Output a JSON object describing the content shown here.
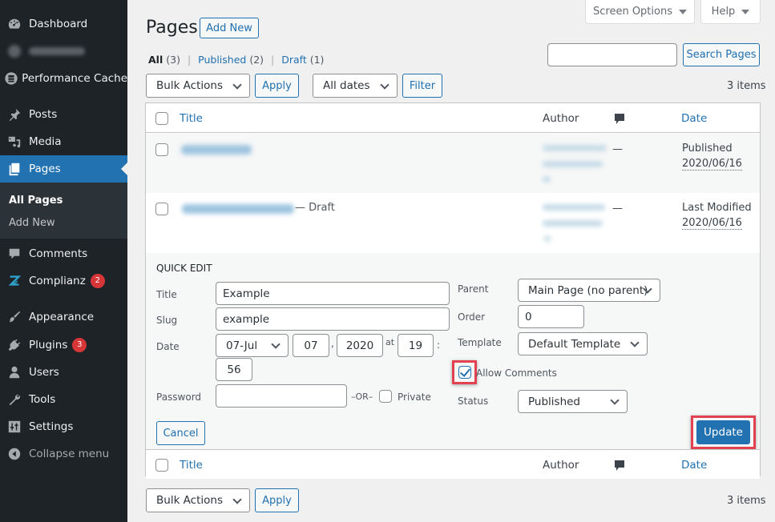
{
  "sidebar": {
    "items": [
      {
        "label": "Dashboard",
        "icon": "dashboard-icon"
      },
      {
        "label": "",
        "icon": "redacted-icon",
        "redacted": true
      },
      {
        "label": "Performance Cache",
        "icon": "cache-icon"
      },
      {
        "label": "Posts",
        "icon": "pin-icon"
      },
      {
        "label": "Media",
        "icon": "media-icon"
      },
      {
        "label": "Pages",
        "icon": "pages-icon",
        "active": true
      },
      {
        "label": "Comments",
        "icon": "comment-icon"
      },
      {
        "label": "Complianz",
        "icon": "complianz-icon",
        "badge": "2"
      },
      {
        "label": "Appearance",
        "icon": "brush-icon"
      },
      {
        "label": "Plugins",
        "icon": "plug-icon",
        "badge": "3"
      },
      {
        "label": "Users",
        "icon": "user-icon"
      },
      {
        "label": "Tools",
        "icon": "wrench-icon"
      },
      {
        "label": "Settings",
        "icon": "settings-icon"
      },
      {
        "label": "Collapse menu",
        "icon": "collapse-icon"
      }
    ],
    "submenu": [
      {
        "label": "All Pages",
        "current": true
      },
      {
        "label": "Add New"
      }
    ]
  },
  "topbar": {
    "screen_options": "Screen Options",
    "help": "Help"
  },
  "header": {
    "title": "Pages",
    "add_new": "Add New"
  },
  "filters": {
    "all": "All",
    "all_count": "(3)",
    "published": "Published",
    "published_count": "(2)",
    "draft": "Draft",
    "draft_count": "(1)",
    "separator": "|"
  },
  "search": {
    "value": "",
    "button": "Search Pages"
  },
  "tablenav": {
    "bulk_actions": "Bulk Actions",
    "apply": "Apply",
    "dates": "All dates",
    "filter": "Filter",
    "items_count": "3 items"
  },
  "table": {
    "columns": {
      "title": "Title",
      "author": "Author",
      "comments_icon": "comment-bubble-icon",
      "date": "Date"
    },
    "rows": [
      {
        "title": "",
        "title_redacted": true,
        "state": "",
        "author_redacted": true,
        "comments": "—",
        "date_status": "Published",
        "date": "2020/06/16"
      },
      {
        "title": "",
        "title_redacted": true,
        "state": "— Draft",
        "author_redacted": true,
        "comments": "—",
        "date_status": "Last Modified",
        "date": "2020/06/16"
      }
    ]
  },
  "quick_edit": {
    "legend": "QUICK EDIT",
    "title_label": "Title",
    "title_value": "Example",
    "slug_label": "Slug",
    "slug_value": "example",
    "date_label": "Date",
    "month": "07-Jul",
    "day": "07",
    "comma": ",",
    "year": "2020",
    "at": "at",
    "hour": "19",
    "colon": ":",
    "minute": "56",
    "password_label": "Password",
    "password_value": "",
    "or": "–OR–",
    "private_label": "Private",
    "private_checked": false,
    "parent_label": "Parent",
    "parent_value": "Main Page (no parent)",
    "order_label": "Order",
    "order_value": "0",
    "template_label": "Template",
    "template_value": "Default Template",
    "allow_comments_label": "Allow Comments",
    "allow_comments_checked": true,
    "status_label": "Status",
    "status_value": "Published",
    "cancel": "Cancel",
    "update": "Update"
  },
  "colors": {
    "accent": "#2271b1",
    "sidebar_bg": "#1d2327",
    "badge": "#d63638",
    "highlight": "#e2424f"
  }
}
